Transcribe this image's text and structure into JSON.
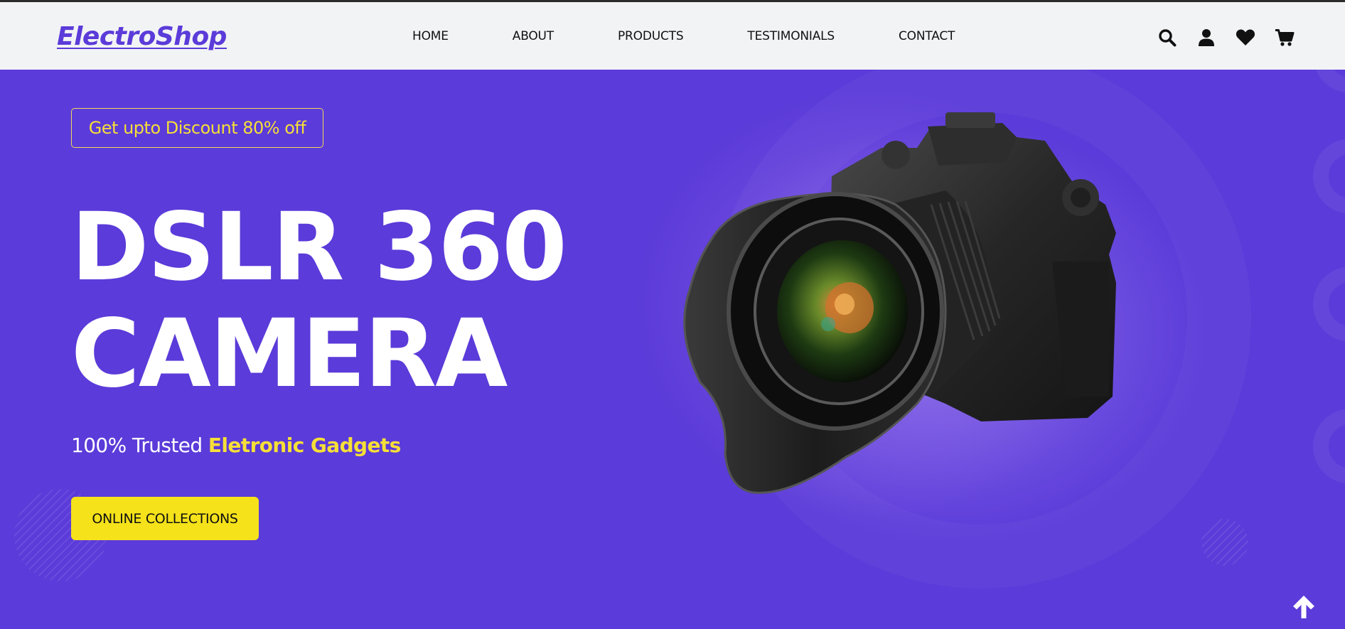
{
  "header": {
    "logo": "ElectroShop",
    "nav": [
      "HOME",
      "ABOUT",
      "PRODUCTS",
      "TESTIMONIALS",
      "CONTACT"
    ],
    "icons": [
      "search-icon",
      "user-icon",
      "heart-icon",
      "cart-icon"
    ]
  },
  "hero": {
    "discount": "Get upto Discount 80% off",
    "headline_line1": "DSLR 360",
    "headline_line2": "CAMERA",
    "tagline_plain": "100% Trusted ",
    "tagline_highlight": "Eletronic Gadgets",
    "cta_label": "ONLINE COLLECTIONS",
    "image": "dslr-camera-image"
  },
  "scroll_top_icon": "arrow-up-icon",
  "colors": {
    "brand": "#5b3bd9",
    "accent_yellow": "#f6df37",
    "button_yellow": "#f5e21a",
    "header_bg": "#f2f3f5"
  }
}
